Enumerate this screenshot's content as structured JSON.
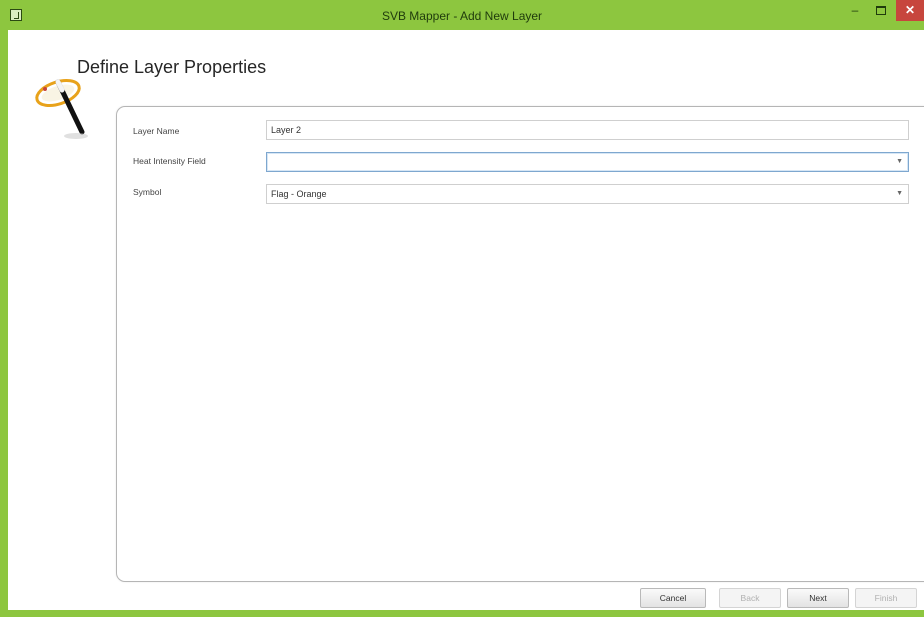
{
  "window": {
    "title": "SVB Mapper - Add New Layer",
    "controls": {
      "minimize": "–",
      "close": "✕"
    }
  },
  "page": {
    "heading": "Define Layer Properties"
  },
  "form": {
    "layer_name": {
      "label": "Layer Name",
      "value": "Layer 2"
    },
    "heat_intensity_field": {
      "label": "Heat Intensity Field",
      "value": ""
    },
    "symbol": {
      "label": "Symbol",
      "value": "Flag - Orange"
    }
  },
  "buttons": {
    "cancel": "Cancel",
    "back": "Back",
    "next": "Next",
    "finish": "Finish"
  },
  "colors": {
    "frame": "#8dc63f",
    "close_button": "#c7463d"
  },
  "icons": {
    "wizard": "magic-wand-icon",
    "dropdown": "chevron-down-icon"
  }
}
